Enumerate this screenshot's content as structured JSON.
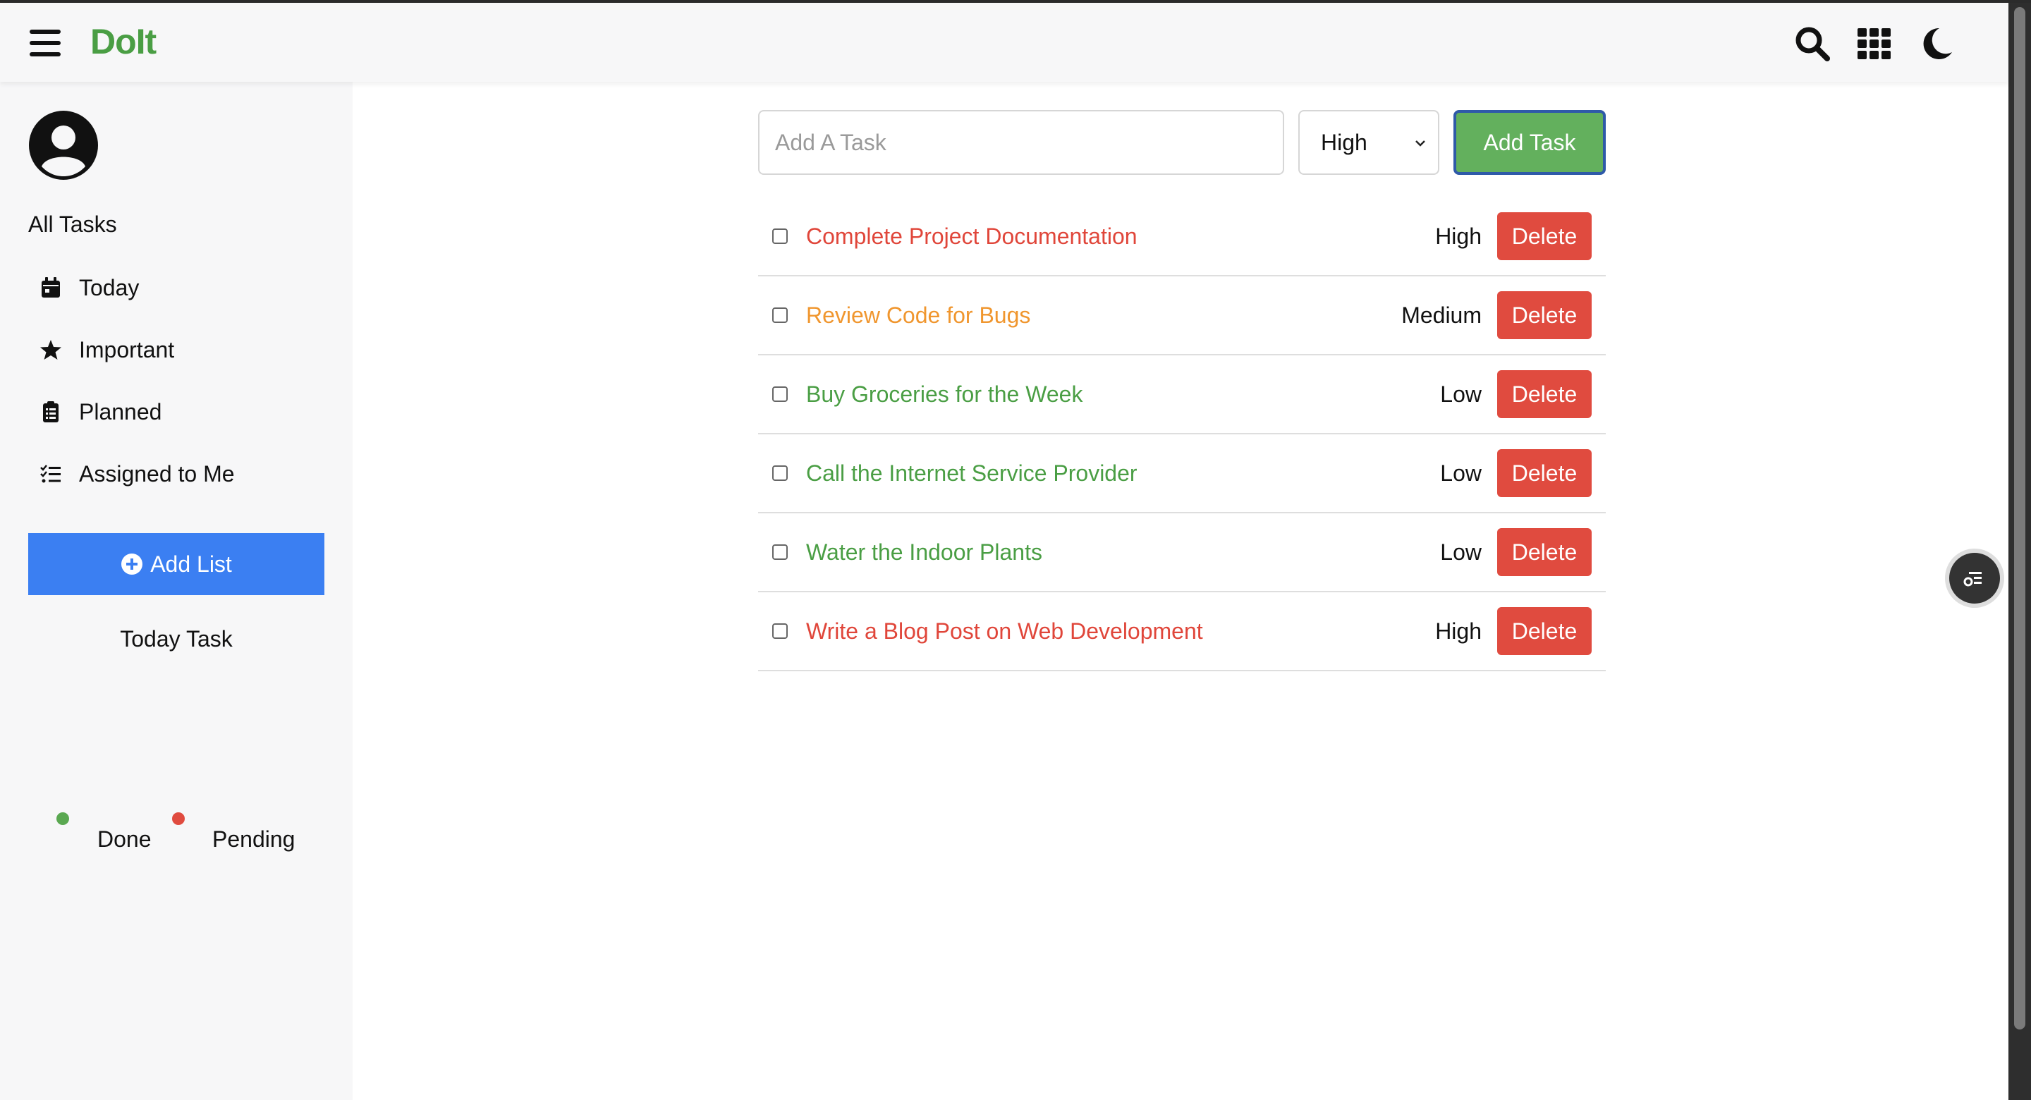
{
  "app": {
    "title": "DoIt",
    "colors": {
      "brand": "#4a9e44",
      "primary": "#3b7ff2",
      "danger": "#e04b3f",
      "success": "#63b05d",
      "high": "#e0463a",
      "medium": "#f0962e",
      "low": "#4a9e44"
    }
  },
  "header": {
    "icons": [
      "hamburger-menu-icon",
      "search-icon",
      "grid-apps-icon",
      "moon-icon"
    ]
  },
  "sidebar": {
    "heading": "All Tasks",
    "items": [
      {
        "label": "Today",
        "icon": "calendar-icon"
      },
      {
        "label": "Important",
        "icon": "star-icon"
      },
      {
        "label": "Planned",
        "icon": "clipboard-icon"
      },
      {
        "label": "Assigned to Me",
        "icon": "checklist-icon"
      }
    ],
    "add_list_label": "Add List",
    "today_task_label": "Today Task",
    "legend": [
      {
        "label": "Done",
        "color": "#5aa851"
      },
      {
        "label": "Pending",
        "color": "#e04b3f"
      }
    ]
  },
  "form": {
    "placeholder": "Add A Task",
    "priority_value": "High",
    "add_button_label": "Add Task"
  },
  "tasks": [
    {
      "text": "Complete Project Documentation",
      "priority": "High",
      "color": "#e0463a",
      "delete_label": "Delete"
    },
    {
      "text": "Review Code for Bugs",
      "priority": "Medium",
      "color": "#f0962e",
      "delete_label": "Delete"
    },
    {
      "text": "Buy Groceries for the Week",
      "priority": "Low",
      "color": "#4a9e44",
      "delete_label": "Delete"
    },
    {
      "text": "Call the Internet Service Provider",
      "priority": "Low",
      "color": "#4a9e44",
      "delete_label": "Delete"
    },
    {
      "text": "Water the Indoor Plants",
      "priority": "Low",
      "color": "#4a9e44",
      "delete_label": "Delete"
    },
    {
      "text": "Write a Blog Post on Web Development",
      "priority": "High",
      "color": "#e0463a",
      "delete_label": "Delete"
    }
  ]
}
